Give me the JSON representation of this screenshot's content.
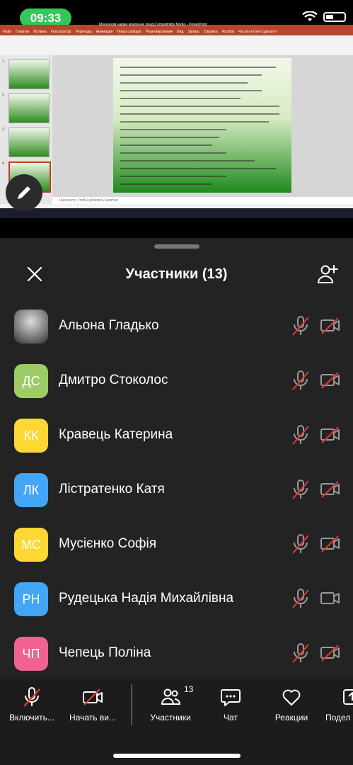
{
  "status_bar": {
    "time": "09:33"
  },
  "shared_screen": {
    "app_title": "Мононорм нарми мовлення пред(Compatibility Mode) - PowerPoint",
    "tabs": [
      "Файл",
      "Главная",
      "Вставка",
      "Конструктор",
      "Переходы",
      "Анимация",
      "Показ слайдов",
      "Рецензирование",
      "Вид",
      "Запись",
      "Справка",
      "Acrobat",
      "Что вы хотите сделать?"
    ],
    "notes_placeholder": "Щелкните, чтобы добавить заметки",
    "slide_numbers": [
      "1",
      "2",
      "3",
      "4"
    ]
  },
  "participants": {
    "title": "Участники (13)",
    "list": [
      {
        "name": "Альона Гладько",
        "initials": "",
        "color": "#888888",
        "photo": true,
        "cam_off": true
      },
      {
        "name": "Дмитро Стоколос",
        "initials": "ДС",
        "color": "#9ccc65",
        "photo": false,
        "cam_off": true
      },
      {
        "name": "Кравець Катерина",
        "initials": "КК",
        "color": "#fdd835",
        "photo": false,
        "cam_off": true
      },
      {
        "name": "Лістратенко Катя",
        "initials": "ЛК",
        "color": "#42a5f5",
        "photo": false,
        "cam_off": true
      },
      {
        "name": "Мусієнко Софія",
        "initials": "МС",
        "color": "#fdd835",
        "photo": false,
        "cam_off": true
      },
      {
        "name": "Рудецька Надія Михайлівна",
        "initials": "РН",
        "color": "#42a5f5",
        "photo": false,
        "cam_off": false
      },
      {
        "name": "Чепець Поліна",
        "initials": "ЧП",
        "color": "#f06292",
        "photo": false,
        "cam_off": true
      }
    ]
  },
  "toolbar": {
    "unmute": "Включить...",
    "start_video": "Начать ви...",
    "participants": "Участники",
    "participants_count": "13",
    "chat": "Чат",
    "reactions": "Реакции",
    "share": "Подел"
  }
}
